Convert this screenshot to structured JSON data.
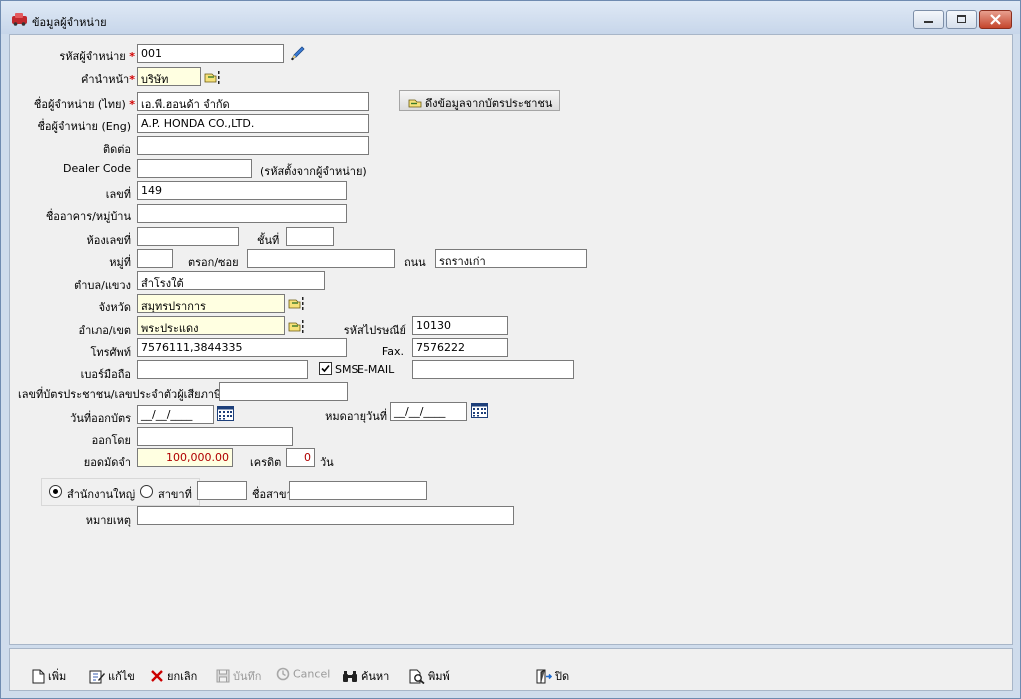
{
  "window": {
    "title": "ข้อมูลผู้จำหน่าย"
  },
  "form": {
    "code_label": "รหัสผู้จำหน่าย",
    "code_value": "001",
    "prefix_label": "คำนำหน้า",
    "prefix_value": "บริษัท",
    "name_th_label": "ชื่อผู้จำหน่าย (ไทย)",
    "name_th_value": "เอ.พี.ฮอนด้า จำกัด",
    "id_card_button": "ดึงข้อมูลจากบัตรประชาชน",
    "name_en_label": "ชื่อผู้จำหน่าย (Eng)",
    "name_en_value": "A.P. HONDA CO.,LTD.",
    "contact_label": "ติดต่อ",
    "contact_value": "",
    "dealer_code_label": "Dealer Code",
    "dealer_code_value": "",
    "dealer_code_hint": "(รหัสตั้งจากผู้จำหน่าย)",
    "house_no_label": "เลขที่",
    "house_no_value": "149",
    "building_label": "ชื่ออาคาร/หมู่บ้าน",
    "building_value": "",
    "room_label": "ห้องเลขที่",
    "room_value": "",
    "floor_label": "ชั้นที่",
    "floor_value": "",
    "moo_label": "หมู่ที่",
    "moo_value": "",
    "soi_label": "ตรอก/ซอย",
    "soi_value": "",
    "road_label": "ถนน",
    "road_value": "รถรางเก่า",
    "subdistrict_label": "ตำบล/แขวง",
    "subdistrict_value": "สำโรงใต้",
    "province_label": "จังหวัด",
    "province_value": "สมุทรปราการ",
    "district_label": "อำเภอ/เขต",
    "district_value": "พระประแดง",
    "postcode_label": "รหัสไปรษณีย์",
    "postcode_value": "10130",
    "phone_label": "โทรศัพท์",
    "phone_value": "7576111,3844335",
    "fax_label": "Fax.",
    "fax_value": "7576222",
    "mobile_label": "เบอร์มือถือ",
    "mobile_value": "",
    "sms_label": "SMS",
    "sms_checked": true,
    "email_label": "E-MAIL",
    "email_value": "",
    "tax_id_label": "เลขที่บัตรประชาชน/เลขประจำตัวผู้เสียภาษี",
    "tax_id_value": "",
    "issue_date_label": "วันที่ออกบัตร",
    "issue_date_value": "__/__/____",
    "expiry_date_label": "หมดอายุวันที่",
    "expiry_date_value": "__/__/____",
    "issued_by_label": "ออกโดย",
    "issued_by_value": "",
    "credit_limit_label": "ยอดมัดจำ",
    "credit_limit_value": "100,000.00",
    "credit_label": "เครดิต",
    "credit_value": "0",
    "credit_unit": "วัน",
    "head_office_label": "สำนักงานใหญ่",
    "branch_label": "สาขาที่",
    "branch_no_value": "",
    "branch_name_label": "ชื่อสาขา",
    "branch_name_value": "",
    "note_label": "หมายเหตุ",
    "note_value": ""
  },
  "toolbar": {
    "add": "เพิ่ม",
    "edit": "แก้ไข",
    "cancel_delete": "ยกเลิก",
    "save": "บันทึก",
    "cancel": "Cancel",
    "search": "ค้นหา",
    "print": "พิมพ์",
    "close": "ปิด"
  },
  "colors": {
    "required": "#d40000",
    "lookup_field": "#ffffe1",
    "credit_text": "#b00000",
    "client_bg": "#f0f0f0",
    "frame": "#cfdcec"
  }
}
